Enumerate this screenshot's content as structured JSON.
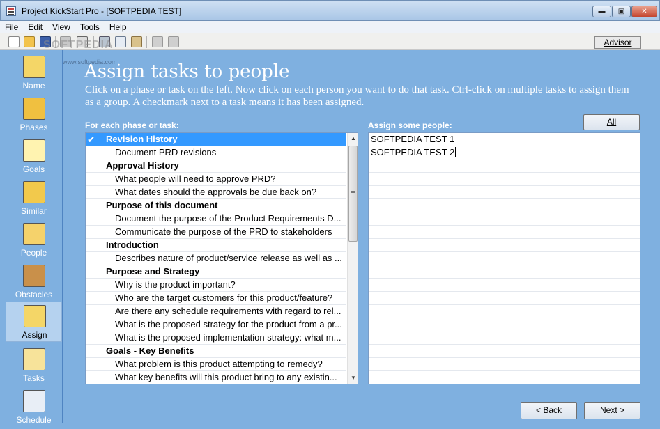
{
  "window": {
    "title": "Project KickStart Pro - [SOFTPEDIA TEST]",
    "min_glyph": "▬",
    "max_glyph": "▣",
    "close_glyph": "✕"
  },
  "menu": {
    "items": [
      "File",
      "Edit",
      "View",
      "Tools",
      "Help"
    ]
  },
  "toolbar": {
    "advisor_label": "Advisor"
  },
  "watermark": {
    "text": "SOFTPEDIA",
    "url": "www.softpedia.com"
  },
  "sidebar": {
    "items": [
      {
        "label": "Name",
        "icon": "pencil-icon"
      },
      {
        "label": "Phases",
        "icon": "phases-icon"
      },
      {
        "label": "Goals",
        "icon": "goals-chart-icon"
      },
      {
        "label": "Similar",
        "icon": "folders-icon"
      },
      {
        "label": "People",
        "icon": "people-icon"
      },
      {
        "label": "Obstacles",
        "icon": "obstacle-icon"
      },
      {
        "label": "Assign",
        "icon": "assign-icon",
        "selected": true
      },
      {
        "label": "Tasks",
        "icon": "clipboard-icon"
      },
      {
        "label": "Schedule",
        "icon": "schedule-icon"
      }
    ]
  },
  "main": {
    "title": "Assign tasks to people",
    "instructions": "Click on a phase or task on the left. Now click on each person you want to do that task. Ctrl-click on multiple tasks to assign them as a group. A checkmark next to a task means it has been assigned.",
    "tasks_label": "For each phase or task:",
    "people_label": "Assign some people:",
    "all_label": "All",
    "check_glyph": "✔",
    "tasks": [
      {
        "type": "phase",
        "text": "Revision History",
        "selected": true,
        "checked": true
      },
      {
        "type": "task",
        "text": "Document PRD revisions"
      },
      {
        "type": "phase",
        "text": "Approval History"
      },
      {
        "type": "task",
        "text": "What people will need to approve PRD?"
      },
      {
        "type": "task",
        "text": "What dates should the approvals be due back on?"
      },
      {
        "type": "phase",
        "text": "Purpose of this document"
      },
      {
        "type": "task",
        "text": "Document the purpose of the Product Requirements D..."
      },
      {
        "type": "task",
        "text": "Communicate the purpose of the PRD to stakeholders"
      },
      {
        "type": "phase",
        "text": "Introduction"
      },
      {
        "type": "task",
        "text": "Describes nature of product/service release as well as ..."
      },
      {
        "type": "phase",
        "text": "Purpose and Strategy"
      },
      {
        "type": "task",
        "text": "Why is the product important?"
      },
      {
        "type": "task",
        "text": "Who are the target customers for this product/feature?"
      },
      {
        "type": "task",
        "text": "Are there any schedule requirements with regard to rel..."
      },
      {
        "type": "task",
        "text": "What is the proposed strategy for the product from a pr..."
      },
      {
        "type": "task",
        "text": "What is the proposed implementation strategy: what m..."
      },
      {
        "type": "phase",
        "text": "Goals - Key Benefits"
      },
      {
        "type": "task",
        "text": "What problem is this product attempting to remedy?"
      },
      {
        "type": "task",
        "text": "What key benefits will this product bring to any existin..."
      }
    ],
    "people": [
      "SOFTPEDIA TEST 1",
      "SOFTPEDIA TEST 2"
    ],
    "scroll_up_glyph": "▲",
    "scroll_down_glyph": "▼"
  },
  "footer": {
    "back_label": "< Back",
    "next_label": "Next >"
  },
  "colors": {
    "background": "#7fb0e0",
    "selection": "#3399ff"
  }
}
